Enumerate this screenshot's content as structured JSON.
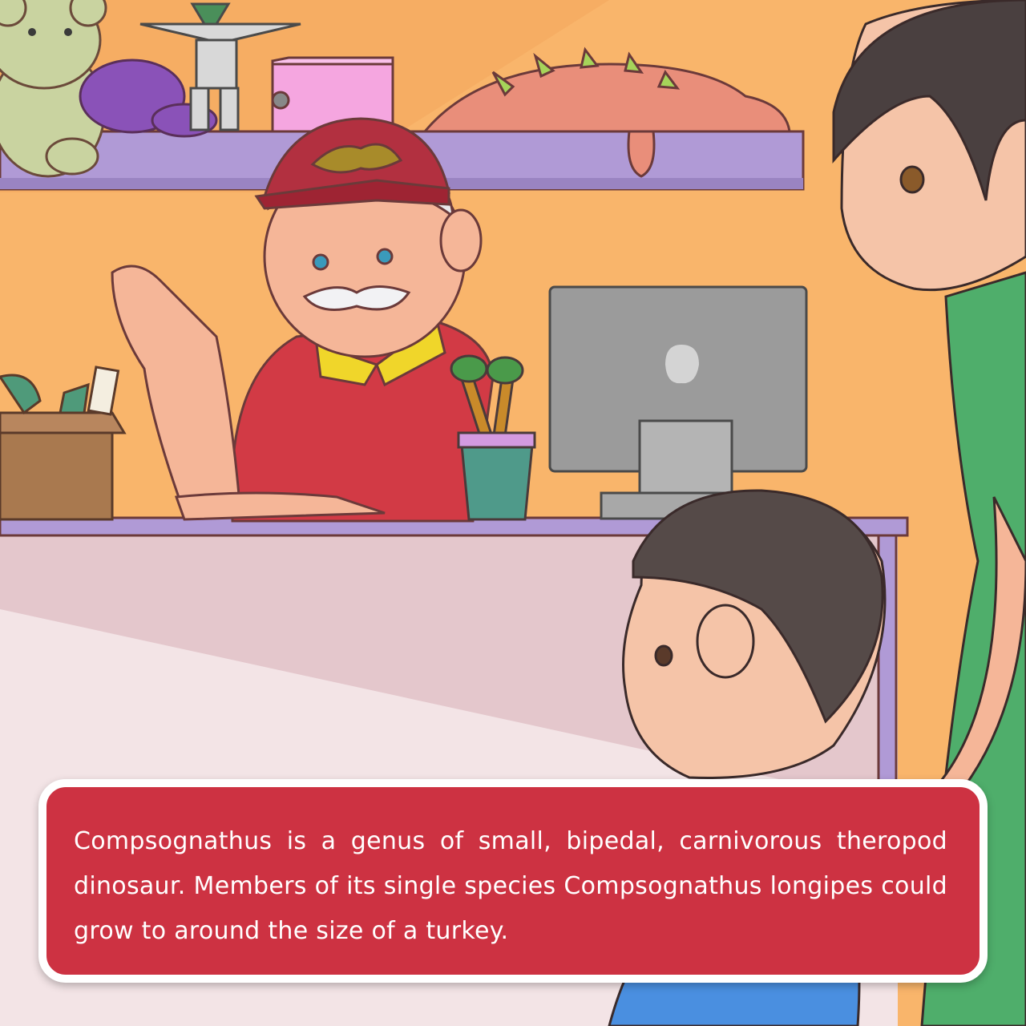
{
  "caption": {
    "text": "Compsognathus is a genus of small, bipedal, carnivorous theropod dinosaur. Members of its single species Compsognathus longipes could grow to around the size of a turkey."
  },
  "colors": {
    "wall": "#f9b56b",
    "shelf": "#b09ad6",
    "shirt_red": "#d23a45",
    "caption_bg": "#cd3242",
    "caption_border": "#ffffff",
    "girl_shirt": "#4fae6b",
    "boy_shirt": "#4a8fe0",
    "monitor": "#9b9b9b"
  },
  "illustration": {
    "figures": [
      "waving-shopkeeper",
      "boy",
      "woman"
    ],
    "objects": [
      "toy-shelf",
      "teddy-bear",
      "robot-toy",
      "pink-pencil-sharpener",
      "dinosaur-plush",
      "computer-monitor",
      "pencil-cup",
      "cardboard-box",
      "counter"
    ]
  }
}
